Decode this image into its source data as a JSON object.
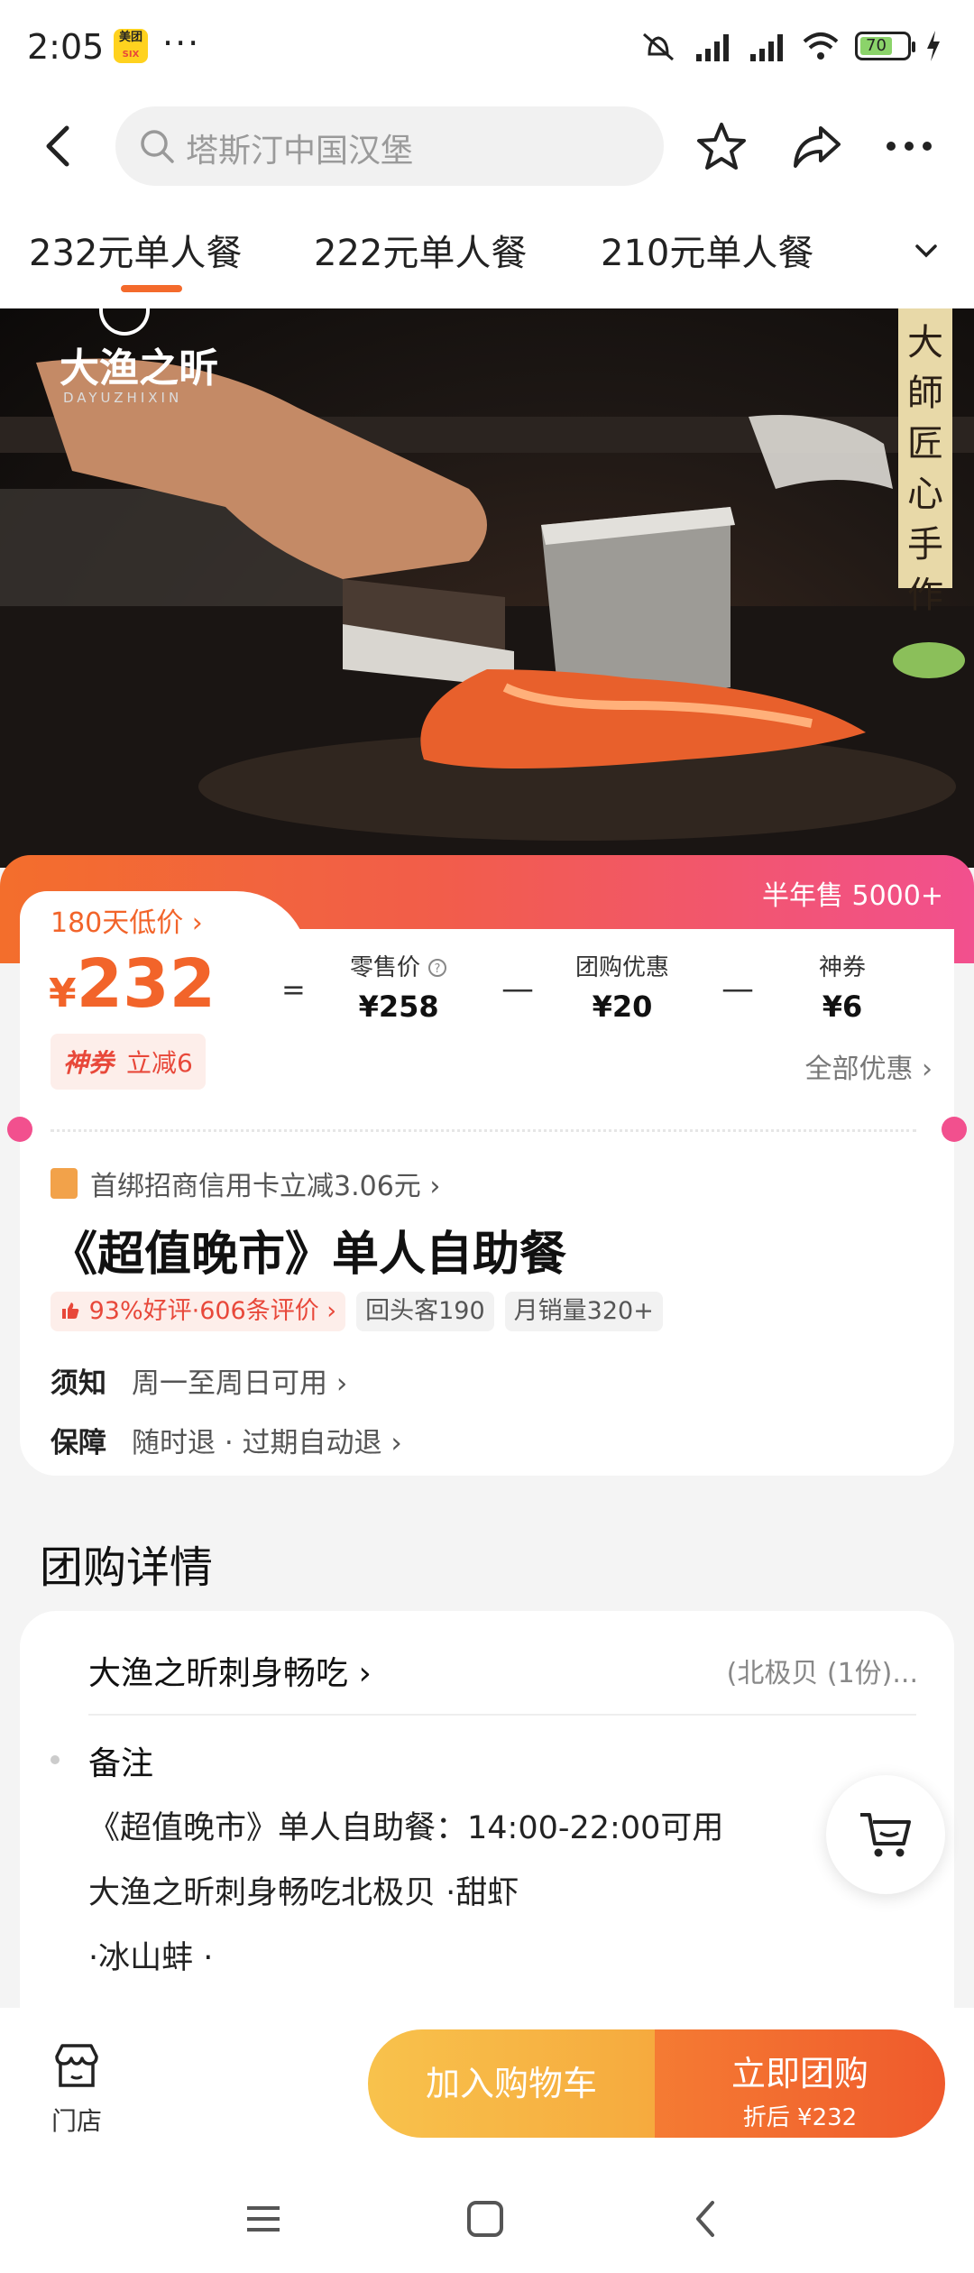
{
  "status_bar": {
    "time": "2:05",
    "app_badge_top": "美团",
    "app_badge_bottom": "SIX",
    "more": "···",
    "battery": "70"
  },
  "header": {
    "search_placeholder": "塔斯汀中国汉堡"
  },
  "tabs": [
    {
      "label": "232元单人餐",
      "active": true
    },
    {
      "label": "222元单人餐",
      "active": false
    },
    {
      "label": "210元单人餐",
      "active": false
    }
  ],
  "hero": {
    "brand_cn": "大渔之昕",
    "brand_en": "DAYUZHIXIN",
    "banner": [
      "大",
      "師",
      "匠",
      "心",
      "手",
      "作"
    ]
  },
  "price_card": {
    "half_year_sales": "半年售 5000+",
    "lowest_label": "180天低价 ›",
    "currency": "¥",
    "price": "232",
    "equals": "=",
    "retail_label": "零售价",
    "retail_value": "¥258",
    "group_label": "团购优惠",
    "group_value": "¥20",
    "coupon_label": "神券",
    "coupon_value": "¥6",
    "minus": "—",
    "badge_label": "神券",
    "badge_text": "立减6",
    "all_offers": "全部优惠 ›",
    "bank_offer": "首绑招商信用卡立减3.06元 ›",
    "deal_title": "《超值晚市》单人自助餐",
    "rating_chip": "93%好评·606条评价 ›",
    "return_chip": "回头客190",
    "sales_chip": "月销量320+",
    "notice_key": "须知",
    "notice_val": "周一至周日可用 ›",
    "guarantee_key": "保障",
    "guarantee_val": "随时退 · 过期自动退 ›"
  },
  "details": {
    "section_title": "团购详情",
    "link": "大渔之昕刺身畅吃 ›",
    "link_right": "(北极贝 (1份)...",
    "note_label": "备注",
    "lines": [
      "《超值晚市》单人自助餐：14:00-22:00可用",
      "大渔之昕刺身畅吃北极贝 ·甜虾",
      "·冰山蚌 ·"
    ]
  },
  "bottom_bar": {
    "store_label": "门店",
    "add_cart": "加入购物车",
    "buy_now": "立即团购",
    "buy_sub": "折后 ¥232"
  },
  "colors": {
    "accent": "#f2642a",
    "gradient_end": "#f2508e",
    "cart_btn": "#f6b544"
  }
}
